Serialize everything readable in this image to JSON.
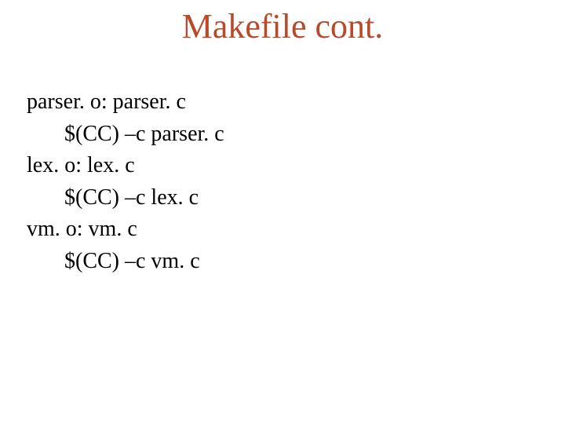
{
  "title": "Makefile cont.",
  "lines": [
    "parser. o: parser. c",
    "$(CC) –c parser. c",
    "lex. o: lex. c",
    "$(CC) –c lex. c",
    "vm. o: vm. c",
    "$(CC) –c vm. c"
  ]
}
